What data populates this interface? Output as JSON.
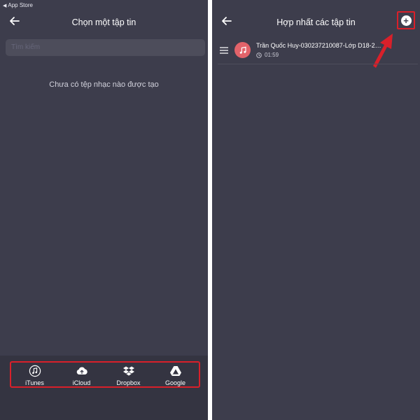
{
  "left": {
    "status": {
      "back_label": "App Store"
    },
    "title": "Chọn một tập tin",
    "search": {
      "placeholder": "Tìm kiếm"
    },
    "empty_message": "Chưa có tệp nhạc nào được tạo",
    "tabs": [
      {
        "label": "iTunes",
        "icon": "music-note-icon"
      },
      {
        "label": "iCloud",
        "icon": "cloud-upload-icon"
      },
      {
        "label": "Dropbox",
        "icon": "dropbox-icon"
      },
      {
        "label": "Google",
        "icon": "google-drive-icon"
      }
    ]
  },
  "right": {
    "title": "Hợp nhất các tập tin",
    "files": [
      {
        "name": "Trần Quốc Huy-030237210087-Lớp D18-2…",
        "duration": "01:59"
      }
    ]
  },
  "colors": {
    "background": "#3d3d4c",
    "bottom_bar": "#343441",
    "highlight": "#d9202a",
    "music_avatar": "#e2636a"
  }
}
